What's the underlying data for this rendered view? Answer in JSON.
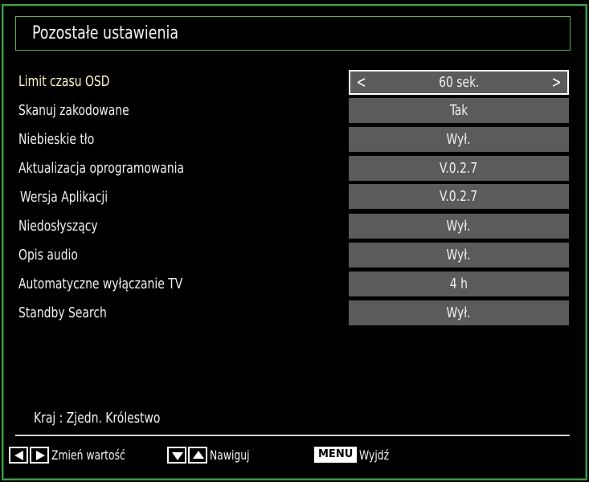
{
  "header": {
    "title": "Pozostałe ustawienia"
  },
  "settings": [
    {
      "label": "Limit czasu OSD",
      "value": "60 sek.",
      "active": true
    },
    {
      "label": "Skanuj zakodowane",
      "value": "Tak"
    },
    {
      "label": "Niebieskie tło",
      "value": "Wył."
    },
    {
      "label": "Aktualizacja oprogramowania",
      "value": "V.0.2.7"
    },
    {
      "label": "Wersja Aplikacji",
      "value": "V.0.2.7"
    },
    {
      "label": "Niedosłyszący",
      "value": "Wył."
    },
    {
      "label": "Opis audio",
      "value": "Wył."
    },
    {
      "label": "Automatyczne wyłączanie TV",
      "value": "4 h"
    },
    {
      "label": "Standby Search",
      "value": "Wył."
    }
  ],
  "selector": {
    "left_arrow": "<",
    "right_arrow": ">"
  },
  "footer": {
    "country": "Kraj : Zjedn. Królestwo",
    "hints": {
      "change_value": "Zmień wartość",
      "navigate": "Nawiguj",
      "menu_key": "MENU",
      "exit": "Wyjdź"
    }
  },
  "colors": {
    "frame_green": "#3f9a48",
    "value_bg": "#5b5b5b",
    "active_label": "#fbf6c8"
  }
}
